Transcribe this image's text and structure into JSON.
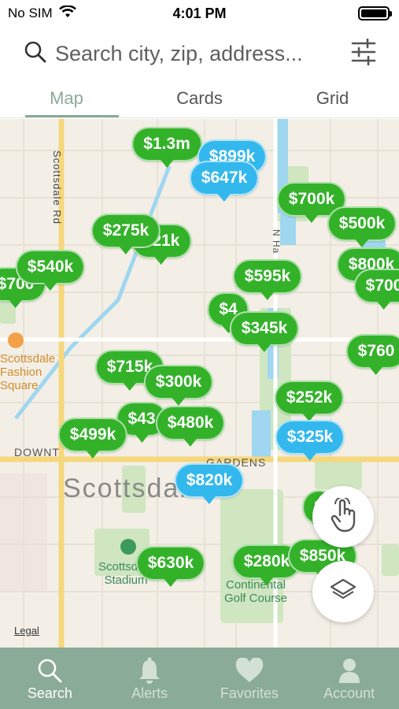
{
  "status_bar": {
    "carrier": "No SIM",
    "time": "4:01 PM",
    "battery_level": 1.0
  },
  "search": {
    "placeholder": "Search city, zip, address..."
  },
  "tabs": [
    {
      "label": "Map",
      "active": true
    },
    {
      "label": "Cards",
      "active": false
    },
    {
      "label": "Grid",
      "active": false
    }
  ],
  "map": {
    "road_labels": [
      "Scottsdale Rd",
      "N Ha",
      "DOWNT",
      "GARDENS"
    ],
    "city_label": "Scottsdale",
    "places": {
      "fashion_square": "Scottsdale Fashion Square",
      "stadium": "Scottsdale Stadium",
      "golf": "Continental Golf Course"
    },
    "legal": "Legal",
    "pins": [
      {
        "label": "$1.3m",
        "color": "green"
      },
      {
        "label": "$899k",
        "color": "blue"
      },
      {
        "label": "$647k",
        "color": "blue"
      },
      {
        "label": "$700k",
        "color": "green"
      },
      {
        "label": "$500k",
        "color": "green"
      },
      {
        "label": "$275k",
        "color": "green"
      },
      {
        "label": "$21k",
        "color": "green"
      },
      {
        "label": "$540k",
        "color": "green"
      },
      {
        "label": "$700",
        "color": "green"
      },
      {
        "label": "$800k",
        "color": "green"
      },
      {
        "label": "$700",
        "color": "green"
      },
      {
        "label": "$595k",
        "color": "green"
      },
      {
        "label": "$4",
        "color": "green"
      },
      {
        "label": "$345k",
        "color": "green"
      },
      {
        "label": "$760",
        "color": "green"
      },
      {
        "label": "$715k",
        "color": "green"
      },
      {
        "label": "$300k",
        "color": "green"
      },
      {
        "label": "$252k",
        "color": "green"
      },
      {
        "label": "$43",
        "color": "green"
      },
      {
        "label": "$480k",
        "color": "green"
      },
      {
        "label": "$499k",
        "color": "green"
      },
      {
        "label": "$325k",
        "color": "blue"
      },
      {
        "label": "$820k",
        "color": "blue"
      },
      {
        "label": "$",
        "color": "green"
      },
      {
        "label": "$630k",
        "color": "green"
      },
      {
        "label": "$280k",
        "color": "green"
      },
      {
        "label": "$850k",
        "color": "green"
      }
    ]
  },
  "nav": [
    {
      "label": "Search",
      "icon": "search-icon",
      "active": true
    },
    {
      "label": "Alerts",
      "icon": "bell-icon",
      "active": false
    },
    {
      "label": "Favorites",
      "icon": "heart-icon",
      "active": false
    },
    {
      "label": "Account",
      "icon": "person-icon",
      "active": false
    }
  ],
  "colors": {
    "accent": "#8aab97",
    "pin_green": "#33b229",
    "pin_blue": "#33b8ee"
  }
}
